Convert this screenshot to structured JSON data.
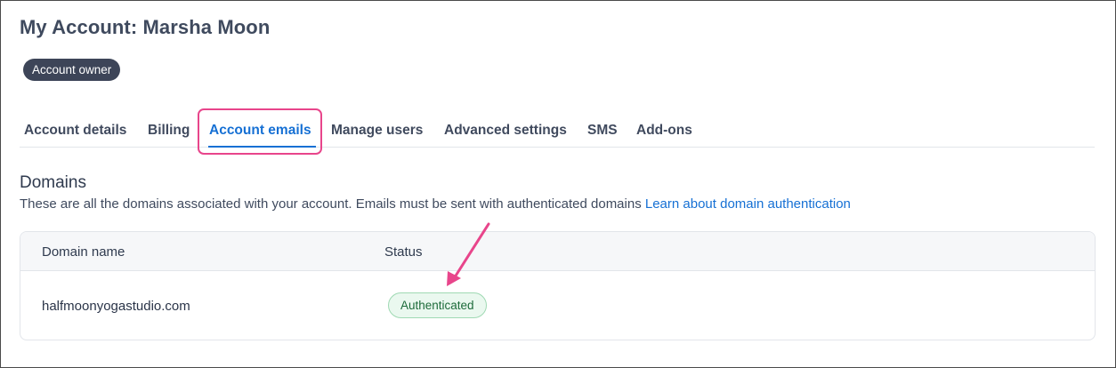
{
  "page": {
    "title": "My Account: Marsha Moon"
  },
  "badge": {
    "label": "Account owner"
  },
  "tabs": [
    {
      "label": "Account details"
    },
    {
      "label": "Billing"
    },
    {
      "label": "Account emails"
    },
    {
      "label": "Manage users"
    },
    {
      "label": "Advanced settings"
    },
    {
      "label": "SMS"
    },
    {
      "label": "Add-ons"
    }
  ],
  "active_tab": "Account emails",
  "domains": {
    "title": "Domains",
    "description": "These are all the domains associated with your account. Emails must be sent with authenticated domains",
    "link_label": "Learn about domain authentication",
    "columns": [
      "Domain name",
      "Status"
    ],
    "rows": [
      {
        "domain": "halfmoonyogastudio.com",
        "status": "Authenticated"
      }
    ]
  },
  "colors": {
    "accent": "#1670d4",
    "highlight": "#e8458b",
    "status_green": "#1d6b3a",
    "badge_dark": "#3d4558"
  }
}
